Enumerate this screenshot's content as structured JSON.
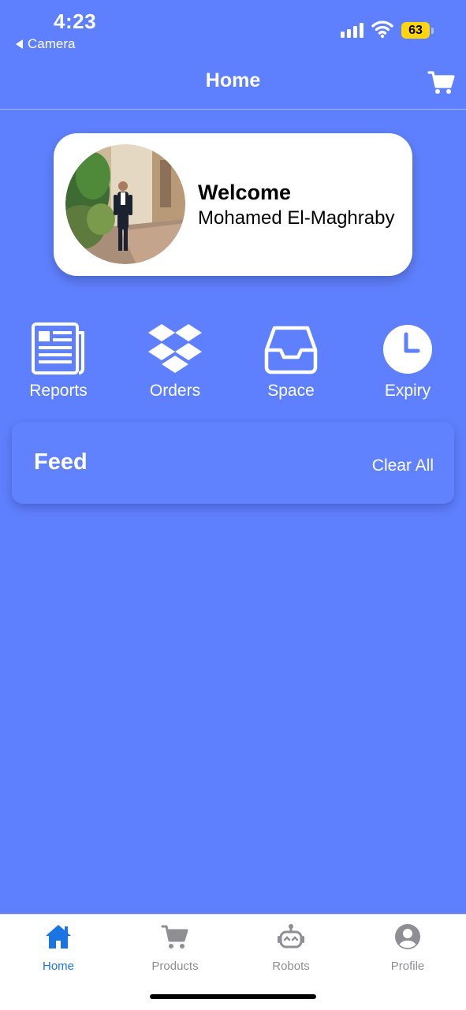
{
  "status_bar": {
    "time": "4:23",
    "back_label": "Camera",
    "battery": "63"
  },
  "header": {
    "title": "Home",
    "cart_icon": "cart-icon"
  },
  "welcome": {
    "greeting": "Welcome",
    "name": "Mohamed El-Maghraby"
  },
  "shortcuts": [
    {
      "label": "Reports",
      "icon": "newspaper-icon"
    },
    {
      "label": "Orders",
      "icon": "boxes-icon"
    },
    {
      "label": "Space",
      "icon": "inbox-tray-icon"
    },
    {
      "label": "Expiry",
      "icon": "clock-icon"
    }
  ],
  "feed": {
    "title": "Feed",
    "clear_label": "Clear All"
  },
  "tabs": [
    {
      "label": "Home",
      "icon": "home-icon",
      "active": true
    },
    {
      "label": "Products",
      "icon": "cart-icon",
      "active": false
    },
    {
      "label": "Robots",
      "icon": "robot-icon",
      "active": false
    },
    {
      "label": "Profile",
      "icon": "profile-icon",
      "active": false
    }
  ],
  "colors": {
    "background": "#5f80fe",
    "tab_active": "#1b74e4",
    "tab_inactive": "#8e8e93",
    "battery": "#ffd60a"
  }
}
